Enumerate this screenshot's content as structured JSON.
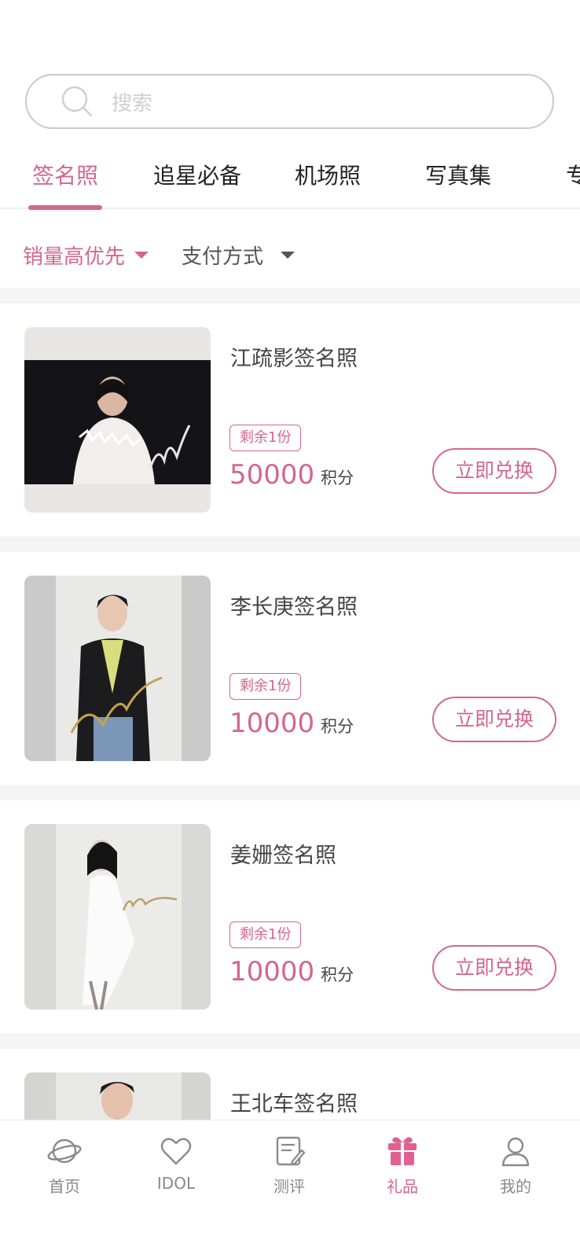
{
  "search": {
    "placeholder": "搜索",
    "icon": "search-icon"
  },
  "tabs": [
    {
      "label": "签名照",
      "active": true
    },
    {
      "label": "追星必备",
      "active": false
    },
    {
      "label": "机场照",
      "active": false
    },
    {
      "label": "写真集",
      "active": false
    },
    {
      "label": "专",
      "active": false
    }
  ],
  "filters": {
    "sort": {
      "label": "销量高优先",
      "icon": "caret-down-icon"
    },
    "payment": {
      "label": "支付方式",
      "icon": "caret-down-icon"
    }
  },
  "products": [
    {
      "title": "江疏影签名照",
      "stock": "剩余1份",
      "price": "50000",
      "unit": "积分",
      "button": "立即兑换"
    },
    {
      "title": "李长庚签名照",
      "stock": "剩余1份",
      "price": "10000",
      "unit": "积分",
      "button": "立即兑换"
    },
    {
      "title": "姜姗签名照",
      "stock": "剩余1份",
      "price": "10000",
      "unit": "积分",
      "button": "立即兑换"
    },
    {
      "title": "王北车签名照",
      "stock": "",
      "price": "",
      "unit": "",
      "button": ""
    }
  ],
  "bottom_nav": [
    {
      "label": "首页",
      "icon": "planet-icon",
      "active": false
    },
    {
      "label": "IDOL",
      "icon": "heart-icon",
      "active": false
    },
    {
      "label": "测评",
      "icon": "review-icon",
      "active": false
    },
    {
      "label": "礼品",
      "icon": "gift-icon",
      "active": true
    },
    {
      "label": "我的",
      "icon": "user-icon",
      "active": false
    }
  ],
  "colors": {
    "accent": "#d4668f",
    "divider": "#f5f5f5",
    "muted": "#888888"
  }
}
